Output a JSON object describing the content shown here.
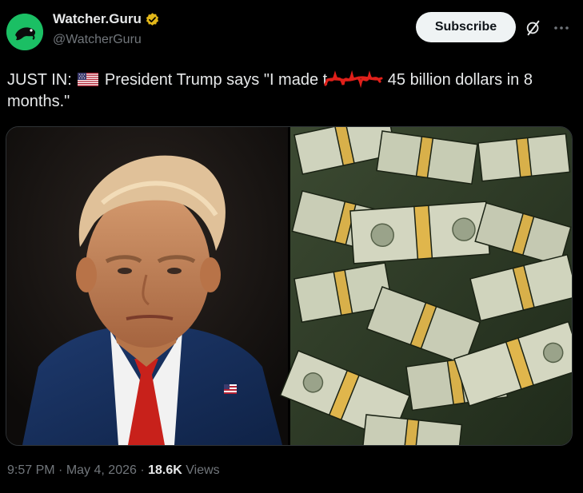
{
  "account": {
    "display_name": "Watcher.Guru",
    "handle": "@WatcherGuru",
    "verified": true,
    "avatar_icon": "whale-logo-icon",
    "avatar_color": "#1bbf64",
    "verified_color": "#e2b719"
  },
  "actions": {
    "subscribe_label": "Subscribe",
    "grok_icon": "grok-icon",
    "more_icon": "more-icon"
  },
  "tweet": {
    "text_prefix": "JUST IN: ",
    "flag_icon": "us-flag-emoji",
    "text_main_before": "President Trump says \"I made t",
    "text_main_after": " 45 billion dollars in 8 months.\"",
    "scribble_icon": "red-scribble-overlay"
  },
  "media": {
    "left_image": "portrait-photo",
    "right_image": "money-stacks-photo"
  },
  "meta": {
    "time": "9:57 PM",
    "date": "May 4, 2026",
    "separator": "·",
    "views_count": "18.6K",
    "views_label": "Views"
  }
}
